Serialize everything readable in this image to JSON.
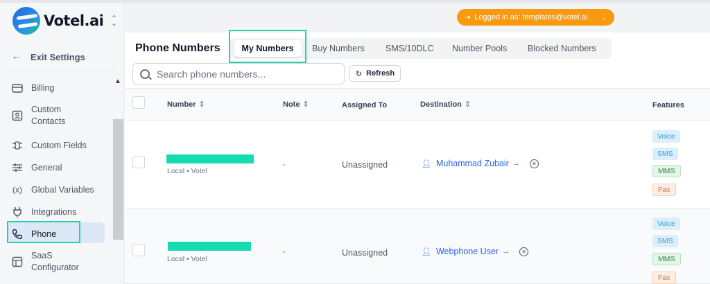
{
  "app": {
    "name": "Votel.ai"
  },
  "sidebar": {
    "exit_label": "Exit Settings",
    "items": [
      {
        "label": "Billing",
        "icon": "credit-card-icon"
      },
      {
        "label": "Custom\nContacts",
        "icon": "contact-card-icon"
      },
      {
        "label": "Custom Fields",
        "icon": "custom-fields-icon"
      },
      {
        "label": "General",
        "icon": "sliders-icon"
      },
      {
        "label": "Global Variables",
        "icon": "variable-icon"
      },
      {
        "label": "Integrations",
        "icon": "plug-icon"
      },
      {
        "label": "Phone",
        "icon": "phone-icon",
        "active": true
      },
      {
        "label": "SaaS\nConfigurator",
        "icon": "saas-icon"
      }
    ]
  },
  "header": {
    "login_label": "Logged in as: templates@votel.ai",
    "accent_color": "#f8990f"
  },
  "page": {
    "title": "Phone Numbers",
    "tabs": [
      {
        "label": "My Numbers",
        "active": true
      },
      {
        "label": "Buy Numbers"
      },
      {
        "label": "SMS/10DLC"
      },
      {
        "label": "Number Pools"
      },
      {
        "label": "Blocked Numbers"
      }
    ],
    "search_placeholder": "Search phone numbers...",
    "refresh_label": "Refresh"
  },
  "table": {
    "columns": [
      "Number",
      "Note",
      "Assigned To",
      "Destination",
      "Features"
    ],
    "rows": [
      {
        "number_sub": "Local • Votel",
        "note": "-",
        "assigned": "Unassigned",
        "destination": "Muhammad Zubair",
        "features": [
          "Voice",
          "SMS",
          "MMS",
          "Fax"
        ]
      },
      {
        "number_sub": "Local • Votel",
        "note": "-",
        "assigned": "Unassigned",
        "destination": "Webphone User",
        "features": [
          "Voice",
          "SMS",
          "MMS",
          "Fax"
        ]
      }
    ]
  }
}
